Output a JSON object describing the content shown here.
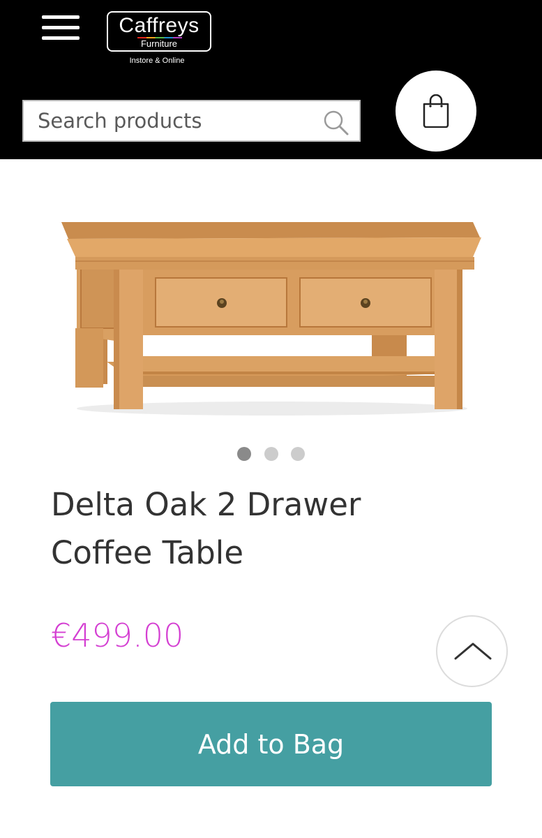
{
  "header": {
    "menu_icon": "hamburger-menu-icon",
    "logo": {
      "name": "Caffreys",
      "subtitle": "Furniture",
      "tagline": "Instore & Online"
    },
    "search": {
      "placeholder": "Search products",
      "value": "",
      "icon": "search-icon"
    },
    "bag_icon": "shopping-bag-icon"
  },
  "product": {
    "image_subject": "oak coffee table with two drawers and lower shelf",
    "carousel": {
      "count": 3,
      "active_index": 0
    },
    "title": "Delta Oak 2 Drawer Coffee Table",
    "price": "€499.00",
    "add_to_bag_label": "Add to Bag"
  },
  "scroll_top_icon": "chevron-up-icon",
  "colors": {
    "header_bg": "#000000",
    "price": "#d43fd2",
    "button_bg": "#459fa2",
    "button_text": "#ffffff",
    "title_text": "#333333"
  }
}
